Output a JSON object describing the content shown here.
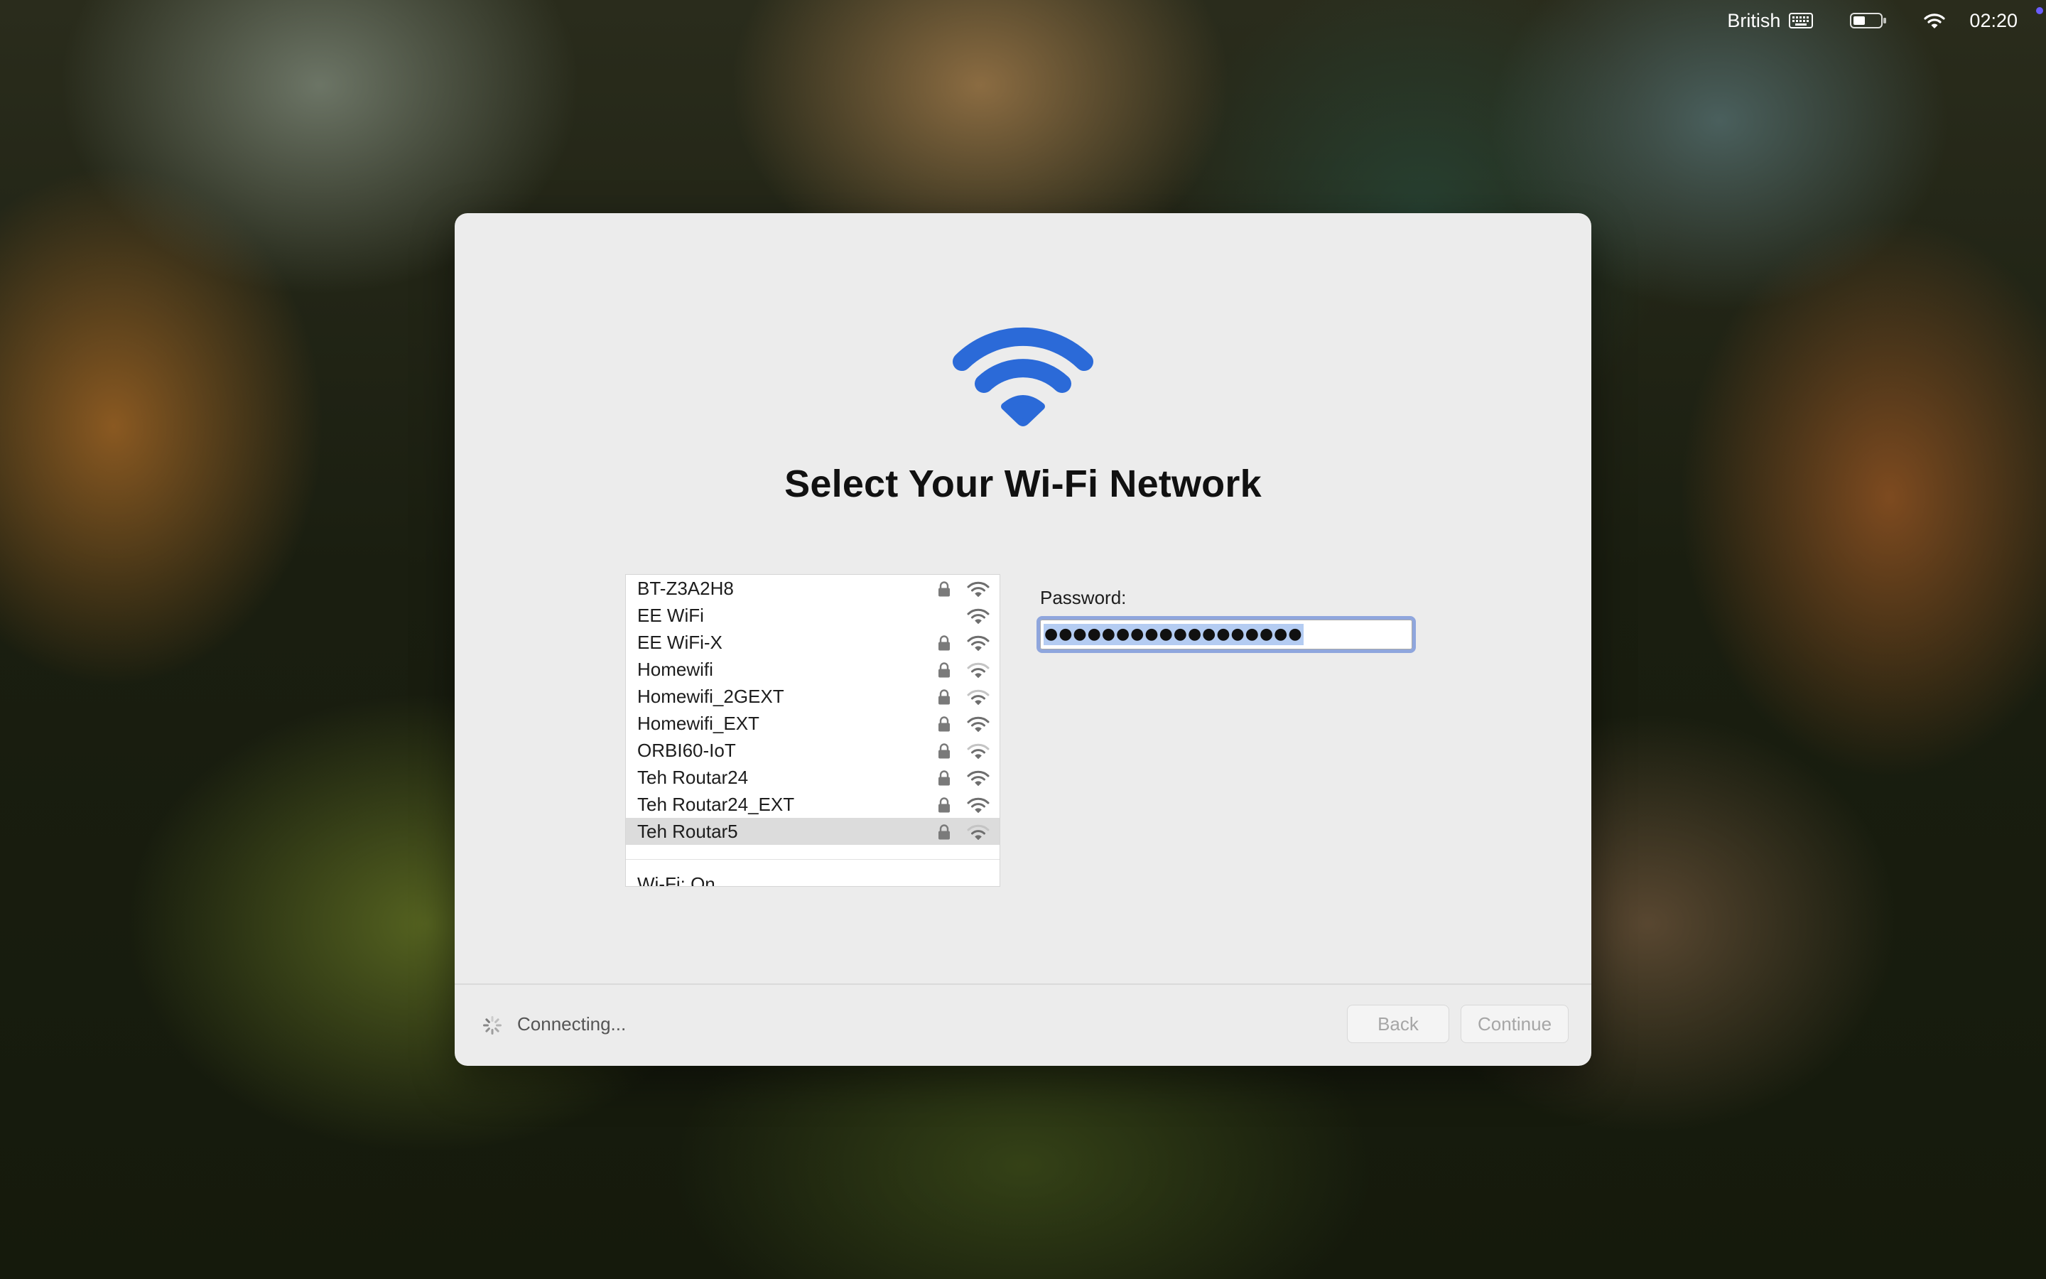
{
  "menubar": {
    "input_source": "British",
    "keyboard_icon": "keyboard-icon",
    "battery_icon": "battery-half-icon",
    "wifi_icon": "wifi-icon",
    "time": "02:20"
  },
  "dialog": {
    "icon": "wifi-icon",
    "title": "Select Your Wi-Fi Network",
    "networks": [
      {
        "name": "BT-Z3A2H8",
        "secured": true,
        "signal": 3
      },
      {
        "name": "EE WiFi",
        "secured": false,
        "signal": 3
      },
      {
        "name": "EE WiFi-X",
        "secured": true,
        "signal": 3
      },
      {
        "name": "Homewifi",
        "secured": true,
        "signal": 2
      },
      {
        "name": "Homewifi_2GEXT",
        "secured": true,
        "signal": 2
      },
      {
        "name": "Homewifi_EXT",
        "secured": true,
        "signal": 3
      },
      {
        "name": "ORBI60-IoT",
        "secured": true,
        "signal": 2
      },
      {
        "name": "Teh Routar24",
        "secured": true,
        "signal": 3
      },
      {
        "name": "Teh Routar24_EXT",
        "secured": true,
        "signal": 3
      },
      {
        "name": "Teh Routar5",
        "secured": true,
        "signal": 2,
        "selected": true
      }
    ],
    "wifi_status": "Wi-Fi: On",
    "password_label": "Password:",
    "password_masked": "●●●●●●●●●●●●●●●●●●",
    "status_text": "Connecting...",
    "back_label": "Back",
    "continue_label": "Continue"
  },
  "colors": {
    "accent": "#2b6ad8",
    "selection": "#b4ccf2",
    "focus_ring": "#8fa6dd"
  }
}
